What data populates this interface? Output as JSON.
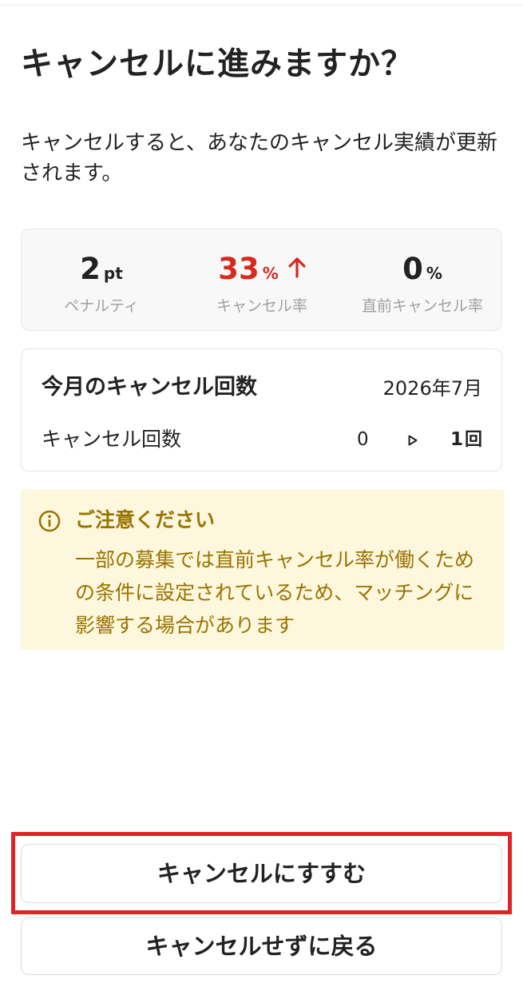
{
  "title": "キャンセルに進みますか？",
  "description": "キャンセルすると、あなたのキャンセル実績が更新されます。",
  "stats": {
    "penalty": {
      "value": "2",
      "unit": "pt",
      "label": "ペナルティ"
    },
    "cancel_rate": {
      "value": "33",
      "unit": "%",
      "label": "キャンセル率",
      "trend": "up",
      "color": "#d42b1e"
    },
    "last_minute_rate": {
      "value": "0",
      "unit": "%",
      "label": "直前キャンセル率"
    }
  },
  "monthly_count": {
    "title": "今月のキャンセル回数",
    "month": "2026年7月",
    "row_label": "キャンセル回数",
    "before": "0",
    "after": "1",
    "after_unit": "回"
  },
  "notice": {
    "icon": "info-icon",
    "title": "ご注意ください",
    "body": "一部の募集では直前キャンセル率が働くための条件に設定されているため、マッチングに影響する場合があります",
    "color": "#9a7400",
    "background": "#fdf8dd"
  },
  "buttons": {
    "proceed_label": "キャンセルにすすむ",
    "back_label": "キャンセルせずに戻る"
  },
  "highlight_color": "#e02424"
}
